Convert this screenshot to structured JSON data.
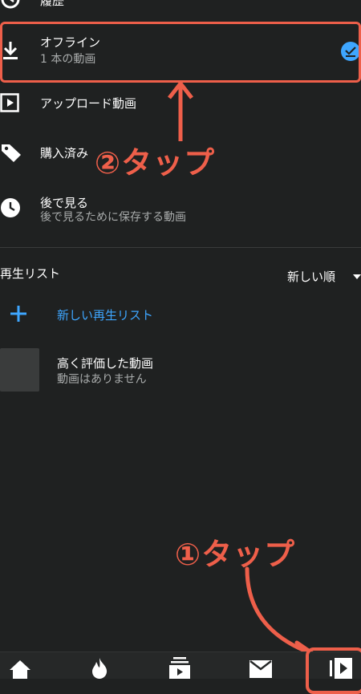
{
  "library": {
    "history": {
      "label": "履歴",
      "icon": "history-icon"
    },
    "offline": {
      "label": "オフライン",
      "subtitle": "1 本の動画",
      "icon": "download-icon",
      "status_icon": "check-badge-icon"
    },
    "uploads": {
      "label": "アップロード動画",
      "icon": "video-play-icon"
    },
    "purchases": {
      "label": "購入済み",
      "icon": "tag-icon"
    },
    "watch_later": {
      "label": "後で見る",
      "subtitle": "後で見るために保存する動画",
      "icon": "clock-icon"
    }
  },
  "playlists": {
    "header": "再生リスト",
    "sort_label": "新しい順",
    "new_playlist_label": "新しい再生リスト",
    "items": [
      {
        "title": "高く評価した動画",
        "subtitle": "動画はありません"
      }
    ]
  },
  "annotations": {
    "step2": "②タップ",
    "step1": "①タップ",
    "color": "#ee5f4a"
  },
  "bottom_nav": {
    "items": [
      {
        "icon": "home-icon"
      },
      {
        "icon": "trending-icon"
      },
      {
        "icon": "subscriptions-icon"
      },
      {
        "icon": "inbox-icon"
      },
      {
        "icon": "library-icon"
      }
    ]
  },
  "colors": {
    "background": "#1f2121",
    "accent_blue": "#3ea6ff",
    "annotation_red": "#ee5f4a"
  }
}
